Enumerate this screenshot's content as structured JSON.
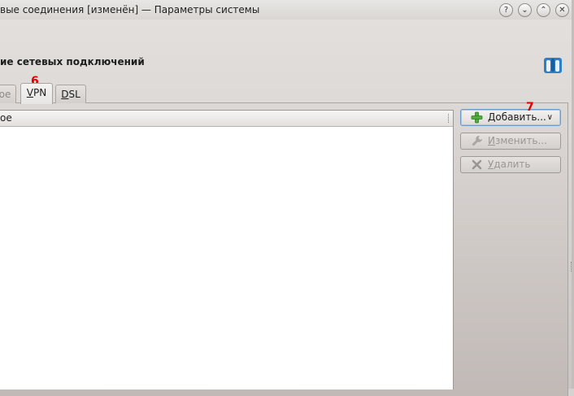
{
  "window": {
    "title": "вые соединения [изменён] — Параметры системы",
    "buttons": [
      "?",
      "⌄",
      "⌃",
      "✕"
    ]
  },
  "header": {
    "title": "ие сетевых подключений",
    "logo_icon": "kde-network-logo"
  },
  "tabs": [
    {
      "label": "ое",
      "access_key": "",
      "rest": "ое",
      "state": "partial"
    },
    {
      "label": "VPN",
      "access_key": "V",
      "rest": "PN",
      "state": "active"
    },
    {
      "label": "DSL",
      "access_key": "D",
      "rest": "SL",
      "state": "normal"
    }
  ],
  "list": {
    "column_header": "ое",
    "rows": []
  },
  "actions": {
    "add": {
      "label": "Добавить...",
      "icon": "plus-icon",
      "enabled": true
    },
    "edit": {
      "label": "Изменить...",
      "access_key": "И",
      "rest": "зменить...",
      "icon": "wrench-icon",
      "enabled": false
    },
    "delete": {
      "label": "Удалить",
      "access_key": "У",
      "rest": "далить",
      "icon": "x-icon",
      "enabled": false
    }
  },
  "annotations": {
    "marker_6": "6",
    "marker_7": "7"
  },
  "colors": {
    "annotation": "#e00000",
    "accent": "#6e9bc7"
  }
}
